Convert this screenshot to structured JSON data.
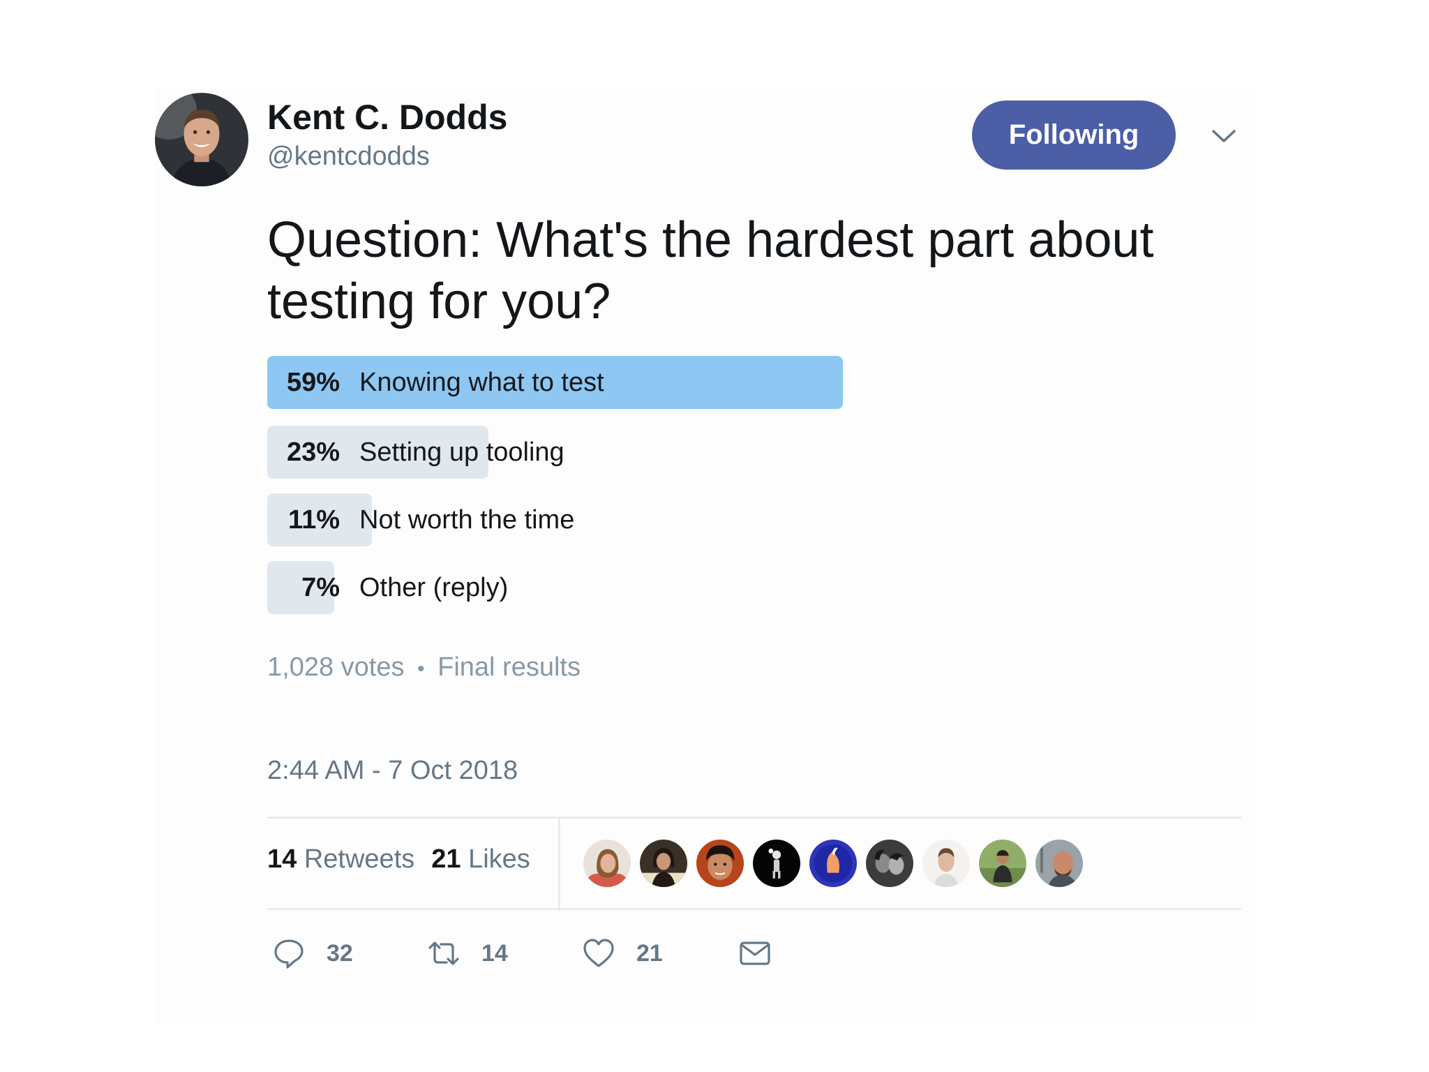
{
  "user": {
    "display_name": "Kent C. Dodds",
    "handle": "@kentcdodds",
    "avatar_icon": "avatar-photo"
  },
  "follow_button": {
    "label": "Following",
    "color": "#4c5ea6"
  },
  "menu": {
    "icon": "chevron-down-icon"
  },
  "tweet": {
    "text": "Question: What's the hardest part about testing for you?"
  },
  "poll": {
    "options": [
      {
        "percent_label": "59%",
        "percent": 59,
        "label": "Knowing what to test",
        "winner": true
      },
      {
        "percent_label": "23%",
        "percent": 23,
        "label": "Setting up tooling",
        "winner": false
      },
      {
        "percent_label": "11%",
        "percent": 11,
        "label": "Not worth the time",
        "winner": false
      },
      {
        "percent_label": "7%",
        "percent": 7,
        "label": "Other (reply)",
        "winner": false
      }
    ],
    "votes": "1,028 votes",
    "separator": "•",
    "status": "Final results",
    "winner_color": "#8ec7f2",
    "bar_color": "#e1e8ed"
  },
  "timestamp": "2:44 AM - 7 Oct 2018",
  "stats": {
    "retweets_count": "14",
    "retweets_label": "Retweets",
    "likes_count": "21",
    "likes_label": "Likes"
  },
  "likers": [
    {
      "icon": "liker-avatar-1"
    },
    {
      "icon": "liker-avatar-2"
    },
    {
      "icon": "liker-avatar-3"
    },
    {
      "icon": "liker-avatar-4"
    },
    {
      "icon": "liker-avatar-5"
    },
    {
      "icon": "liker-avatar-6"
    },
    {
      "icon": "liker-avatar-7"
    },
    {
      "icon": "liker-avatar-8"
    },
    {
      "icon": "liker-avatar-9"
    }
  ],
  "actions": {
    "reply_count": "32",
    "retweet_count": "14",
    "like_count": "21",
    "reply_icon": "reply-icon",
    "retweet_icon": "retweet-icon",
    "like_icon": "heart-icon",
    "dm_icon": "envelope-icon"
  }
}
